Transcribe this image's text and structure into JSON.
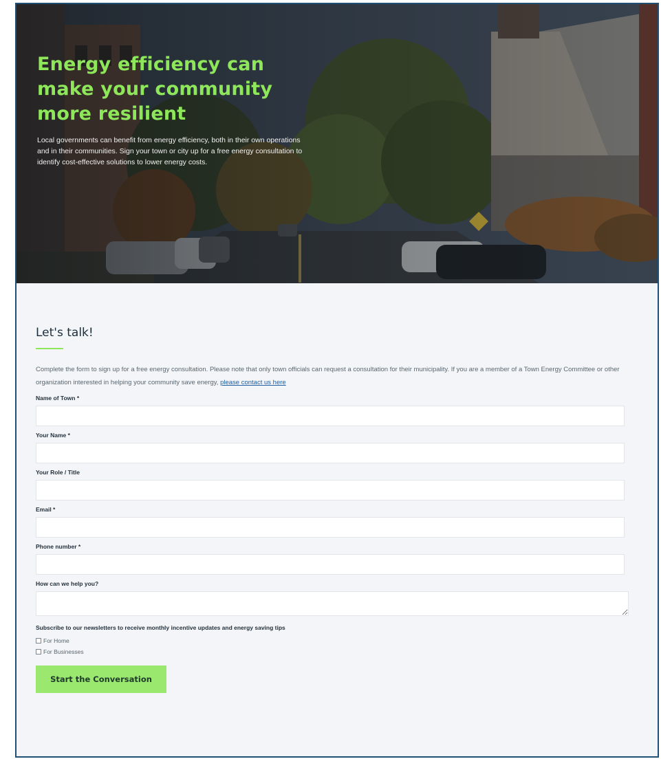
{
  "hero": {
    "title": "Energy efficiency can make your community more resilient",
    "body": "Local governments can benefit from energy efficiency, both in their own operations and in their communities. Sign your town or city up for a free energy consultation to identify cost-effective solutions to lower energy costs."
  },
  "form": {
    "heading": "Let's talk!",
    "intro_text": "Complete the form to sign up for a free energy consultation. Please note that only town officials can request a consultation for their municipality. If you are a member of a Town Energy Committee or other organization interested in helping your community save energy,",
    "intro_link": "please contact us here",
    "fields": {
      "town": {
        "label": "Name of Town *",
        "value": ""
      },
      "name": {
        "label": "Your Name *",
        "value": ""
      },
      "role": {
        "label": "Your Role / Title",
        "value": ""
      },
      "email": {
        "label": "Email *",
        "value": ""
      },
      "phone": {
        "label": "Phone number *",
        "value": ""
      },
      "help": {
        "label": "How can we help you?",
        "value": ""
      }
    },
    "newsletter": {
      "label": "Subscribe to our newsletters to receive monthly incentive updates and energy saving tips",
      "options": [
        "For Home",
        "For Businesses"
      ],
      "checked": [
        false,
        false
      ]
    },
    "submit_label": "Start the Conversation"
  },
  "colors": {
    "accent_green": "#8ee65a",
    "button_green": "#9ae86e",
    "frame_border": "#1f4f73",
    "background": "#f3f5f8"
  }
}
